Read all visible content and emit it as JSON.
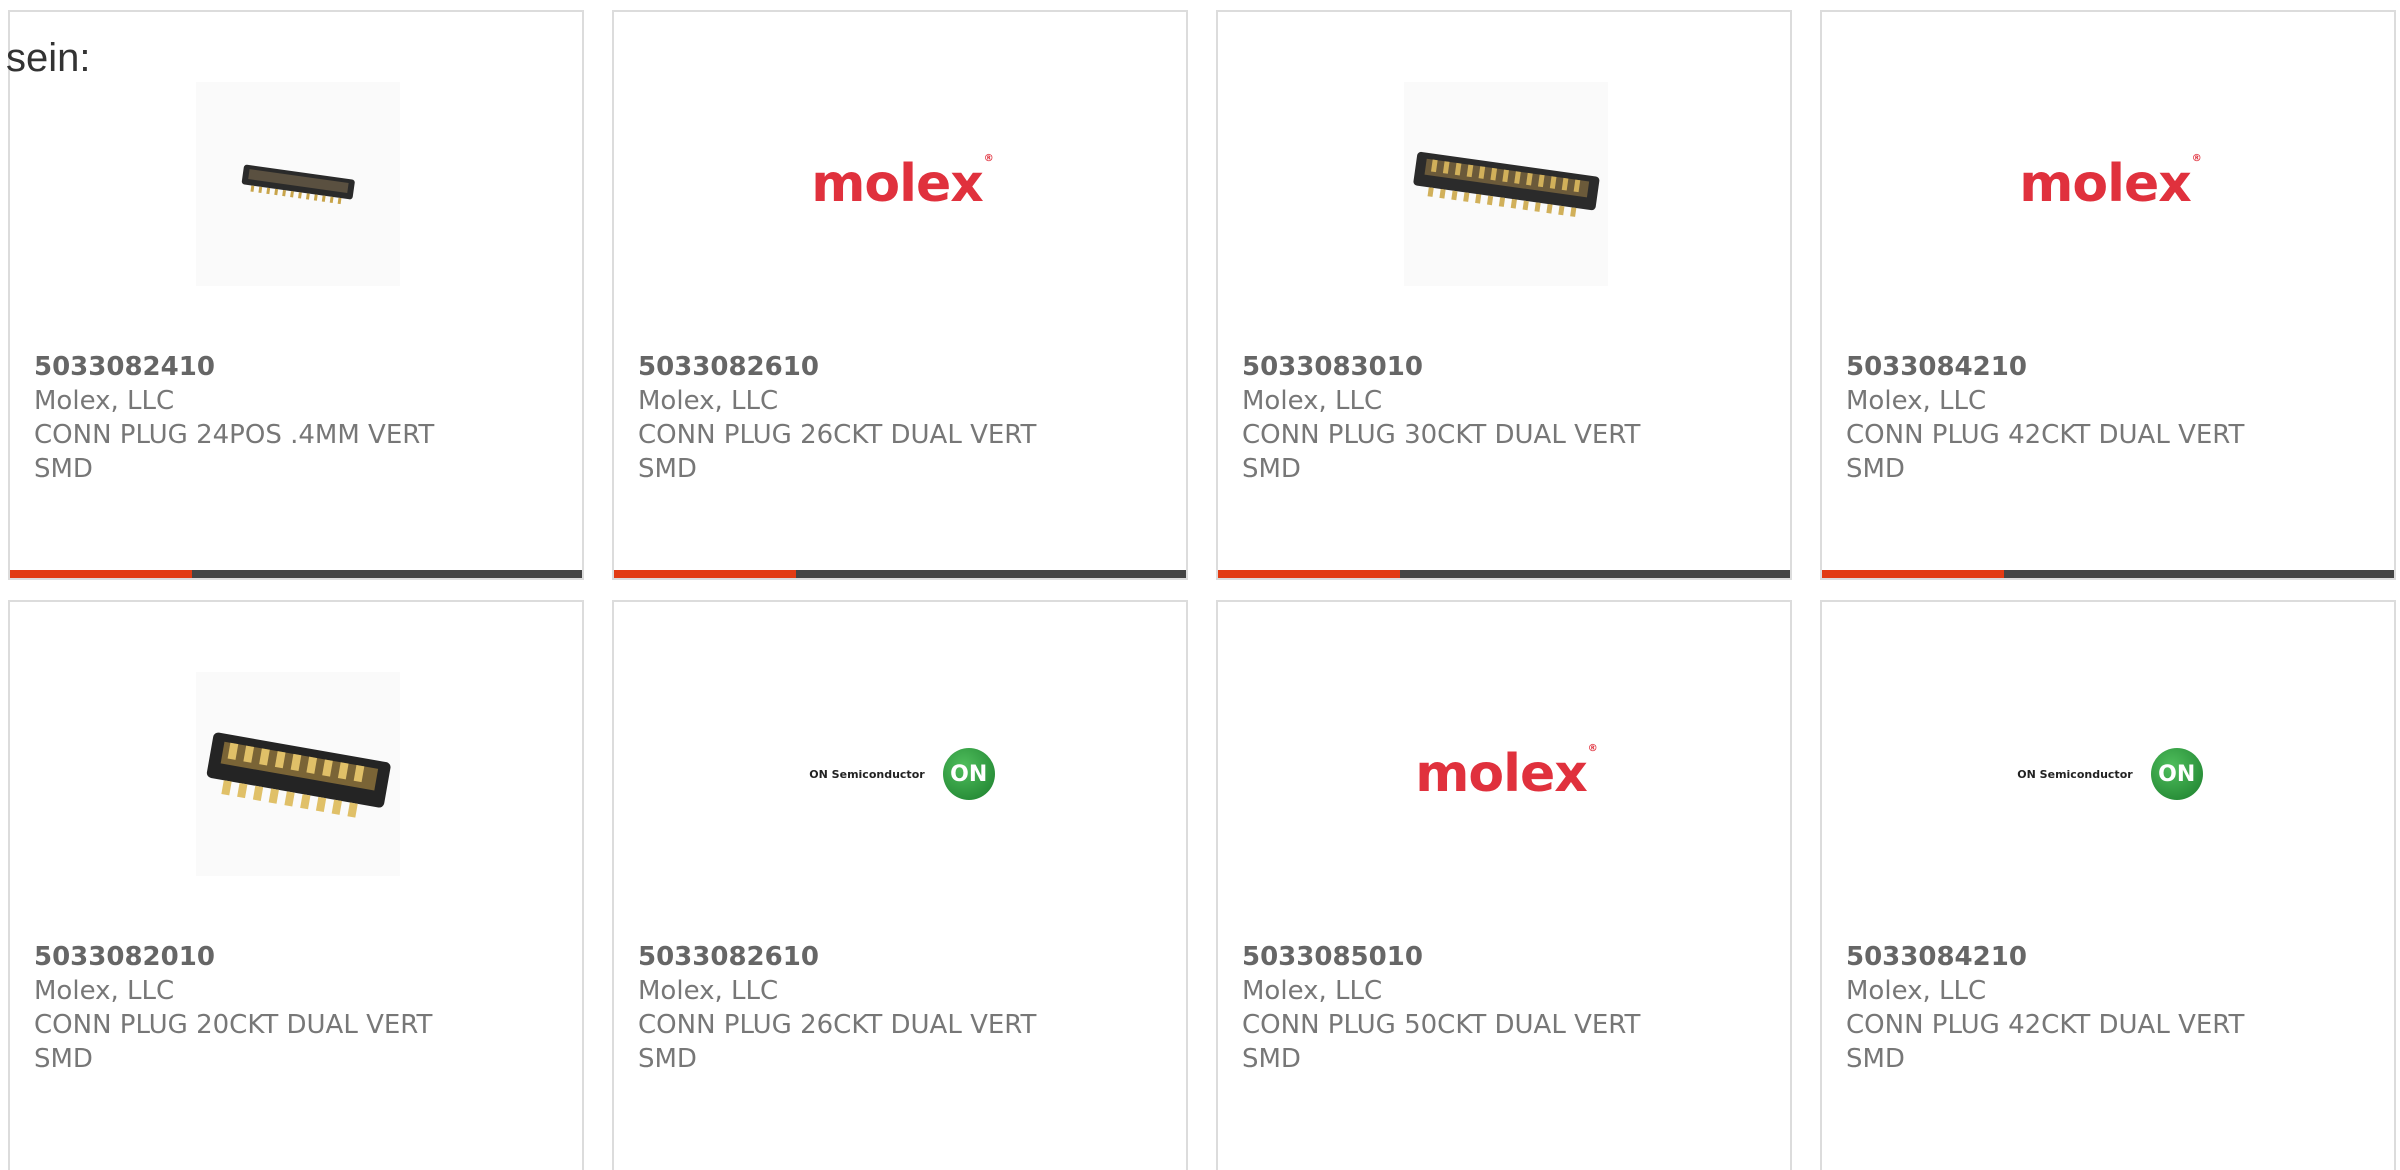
{
  "intro_text": "sein:",
  "accent_color": "#e23b13",
  "bar_color": "#444444",
  "products": [
    {
      "part_number": "5033082410",
      "manufacturer": "Molex, LLC",
      "description": "CONN PLUG 24POS .4MM VERT SMD",
      "image": "connector-small-icon"
    },
    {
      "part_number": "5033082610",
      "manufacturer": "Molex, LLC",
      "description": "CONN PLUG 26CKT DUAL VERT SMD",
      "image": "molex-logo",
      "logo_text": "molex"
    },
    {
      "part_number": "5033083010",
      "manufacturer": "Molex, LLC",
      "description": "CONN PLUG 30CKT DUAL VERT SMD",
      "image": "connector-gold-pins-icon"
    },
    {
      "part_number": "5033084210",
      "manufacturer": "Molex, LLC",
      "description": "CONN PLUG 42CKT DUAL VERT SMD",
      "image": "molex-logo",
      "logo_text": "molex"
    },
    {
      "part_number": "5033082010",
      "manufacturer": "Molex, LLC",
      "description": "CONN PLUG 20CKT DUAL VERT SMD",
      "image": "connector-large-gold-icon"
    },
    {
      "part_number": "5033082610",
      "manufacturer": "Molex, LLC",
      "description": "CONN PLUG 26CKT DUAL VERT SMD",
      "image": "on-semiconductor-logo",
      "logo_text": "ON Semiconductor",
      "badge_text": "ON"
    },
    {
      "part_number": "5033085010",
      "manufacturer": "Molex, LLC",
      "description": "CONN PLUG 50CKT DUAL VERT SMD",
      "image": "molex-logo",
      "logo_text": "molex"
    },
    {
      "part_number": "5033084210",
      "manufacturer": "Molex, LLC",
      "description": "CONN PLUG 42CKT DUAL VERT SMD",
      "image": "on-semiconductor-logo",
      "logo_text": "ON Semiconductor",
      "badge_text": "ON"
    }
  ]
}
